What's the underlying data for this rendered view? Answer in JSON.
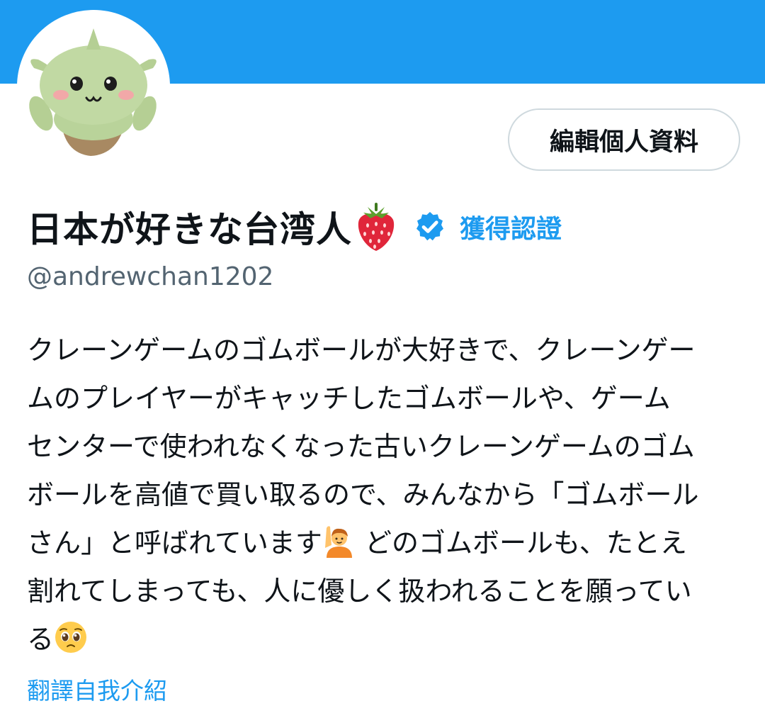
{
  "profile": {
    "display_name": "日本が好きな台湾人",
    "handle": "@andrewchan1202",
    "verified_label": "獲得認證",
    "edit_button_label": "編輯個人資料",
    "translate_label": "翻譯自我介紹",
    "bio_lines": [
      "クレーンゲームのゴムボールが大好きで、クレーンゲー",
      "ムのプレイヤーがキャッチしたゴムボールや、ゲーム",
      "センターで使われなくなった古いクレーンゲームのゴム",
      "ボールを高値で買い取るので、みんなから「ゴムボール",
      "さん」と呼ばれています",
      " どのゴムボールも、たとえ",
      "割れてしまっても、人に優しく扱われることを願ってい",
      "る"
    ],
    "icons": {
      "name_emoji": "strawberry-icon",
      "verified": "verified-badge-icon",
      "bio_emoji_1": "person-raising-hand-icon",
      "bio_emoji_2": "pleading-face-icon",
      "avatar": "plush-avatar-image"
    }
  },
  "colors": {
    "banner": "#1d9bf0",
    "accent": "#1d9bf0",
    "text": "#0f1419",
    "secondary_text": "#536471",
    "button_border": "#cfd9de"
  }
}
